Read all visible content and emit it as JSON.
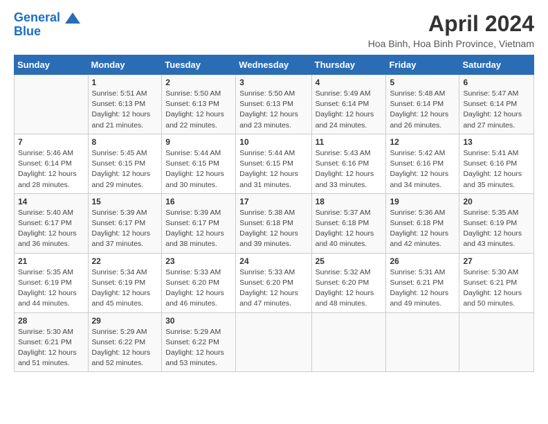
{
  "header": {
    "logo_line1": "General",
    "logo_line2": "Blue",
    "month_title": "April 2024",
    "subtitle": "Hoa Binh, Hoa Binh Province, Vietnam"
  },
  "days_of_week": [
    "Sunday",
    "Monday",
    "Tuesday",
    "Wednesday",
    "Thursday",
    "Friday",
    "Saturday"
  ],
  "weeks": [
    [
      {
        "day": "",
        "info": ""
      },
      {
        "day": "1",
        "info": "Sunrise: 5:51 AM\nSunset: 6:13 PM\nDaylight: 12 hours\nand 21 minutes."
      },
      {
        "day": "2",
        "info": "Sunrise: 5:50 AM\nSunset: 6:13 PM\nDaylight: 12 hours\nand 22 minutes."
      },
      {
        "day": "3",
        "info": "Sunrise: 5:50 AM\nSunset: 6:13 PM\nDaylight: 12 hours\nand 23 minutes."
      },
      {
        "day": "4",
        "info": "Sunrise: 5:49 AM\nSunset: 6:14 PM\nDaylight: 12 hours\nand 24 minutes."
      },
      {
        "day": "5",
        "info": "Sunrise: 5:48 AM\nSunset: 6:14 PM\nDaylight: 12 hours\nand 26 minutes."
      },
      {
        "day": "6",
        "info": "Sunrise: 5:47 AM\nSunset: 6:14 PM\nDaylight: 12 hours\nand 27 minutes."
      }
    ],
    [
      {
        "day": "7",
        "info": "Sunrise: 5:46 AM\nSunset: 6:14 PM\nDaylight: 12 hours\nand 28 minutes."
      },
      {
        "day": "8",
        "info": "Sunrise: 5:45 AM\nSunset: 6:15 PM\nDaylight: 12 hours\nand 29 minutes."
      },
      {
        "day": "9",
        "info": "Sunrise: 5:44 AM\nSunset: 6:15 PM\nDaylight: 12 hours\nand 30 minutes."
      },
      {
        "day": "10",
        "info": "Sunrise: 5:44 AM\nSunset: 6:15 PM\nDaylight: 12 hours\nand 31 minutes."
      },
      {
        "day": "11",
        "info": "Sunrise: 5:43 AM\nSunset: 6:16 PM\nDaylight: 12 hours\nand 33 minutes."
      },
      {
        "day": "12",
        "info": "Sunrise: 5:42 AM\nSunset: 6:16 PM\nDaylight: 12 hours\nand 34 minutes."
      },
      {
        "day": "13",
        "info": "Sunrise: 5:41 AM\nSunset: 6:16 PM\nDaylight: 12 hours\nand 35 minutes."
      }
    ],
    [
      {
        "day": "14",
        "info": "Sunrise: 5:40 AM\nSunset: 6:17 PM\nDaylight: 12 hours\nand 36 minutes."
      },
      {
        "day": "15",
        "info": "Sunrise: 5:39 AM\nSunset: 6:17 PM\nDaylight: 12 hours\nand 37 minutes."
      },
      {
        "day": "16",
        "info": "Sunrise: 5:39 AM\nSunset: 6:17 PM\nDaylight: 12 hours\nand 38 minutes."
      },
      {
        "day": "17",
        "info": "Sunrise: 5:38 AM\nSunset: 6:18 PM\nDaylight: 12 hours\nand 39 minutes."
      },
      {
        "day": "18",
        "info": "Sunrise: 5:37 AM\nSunset: 6:18 PM\nDaylight: 12 hours\nand 40 minutes."
      },
      {
        "day": "19",
        "info": "Sunrise: 5:36 AM\nSunset: 6:18 PM\nDaylight: 12 hours\nand 42 minutes."
      },
      {
        "day": "20",
        "info": "Sunrise: 5:35 AM\nSunset: 6:19 PM\nDaylight: 12 hours\nand 43 minutes."
      }
    ],
    [
      {
        "day": "21",
        "info": "Sunrise: 5:35 AM\nSunset: 6:19 PM\nDaylight: 12 hours\nand 44 minutes."
      },
      {
        "day": "22",
        "info": "Sunrise: 5:34 AM\nSunset: 6:19 PM\nDaylight: 12 hours\nand 45 minutes."
      },
      {
        "day": "23",
        "info": "Sunrise: 5:33 AM\nSunset: 6:20 PM\nDaylight: 12 hours\nand 46 minutes."
      },
      {
        "day": "24",
        "info": "Sunrise: 5:33 AM\nSunset: 6:20 PM\nDaylight: 12 hours\nand 47 minutes."
      },
      {
        "day": "25",
        "info": "Sunrise: 5:32 AM\nSunset: 6:20 PM\nDaylight: 12 hours\nand 48 minutes."
      },
      {
        "day": "26",
        "info": "Sunrise: 5:31 AM\nSunset: 6:21 PM\nDaylight: 12 hours\nand 49 minutes."
      },
      {
        "day": "27",
        "info": "Sunrise: 5:30 AM\nSunset: 6:21 PM\nDaylight: 12 hours\nand 50 minutes."
      }
    ],
    [
      {
        "day": "28",
        "info": "Sunrise: 5:30 AM\nSunset: 6:21 PM\nDaylight: 12 hours\nand 51 minutes."
      },
      {
        "day": "29",
        "info": "Sunrise: 5:29 AM\nSunset: 6:22 PM\nDaylight: 12 hours\nand 52 minutes."
      },
      {
        "day": "30",
        "info": "Sunrise: 5:29 AM\nSunset: 6:22 PM\nDaylight: 12 hours\nand 53 minutes."
      },
      {
        "day": "",
        "info": ""
      },
      {
        "day": "",
        "info": ""
      },
      {
        "day": "",
        "info": ""
      },
      {
        "day": "",
        "info": ""
      }
    ]
  ]
}
